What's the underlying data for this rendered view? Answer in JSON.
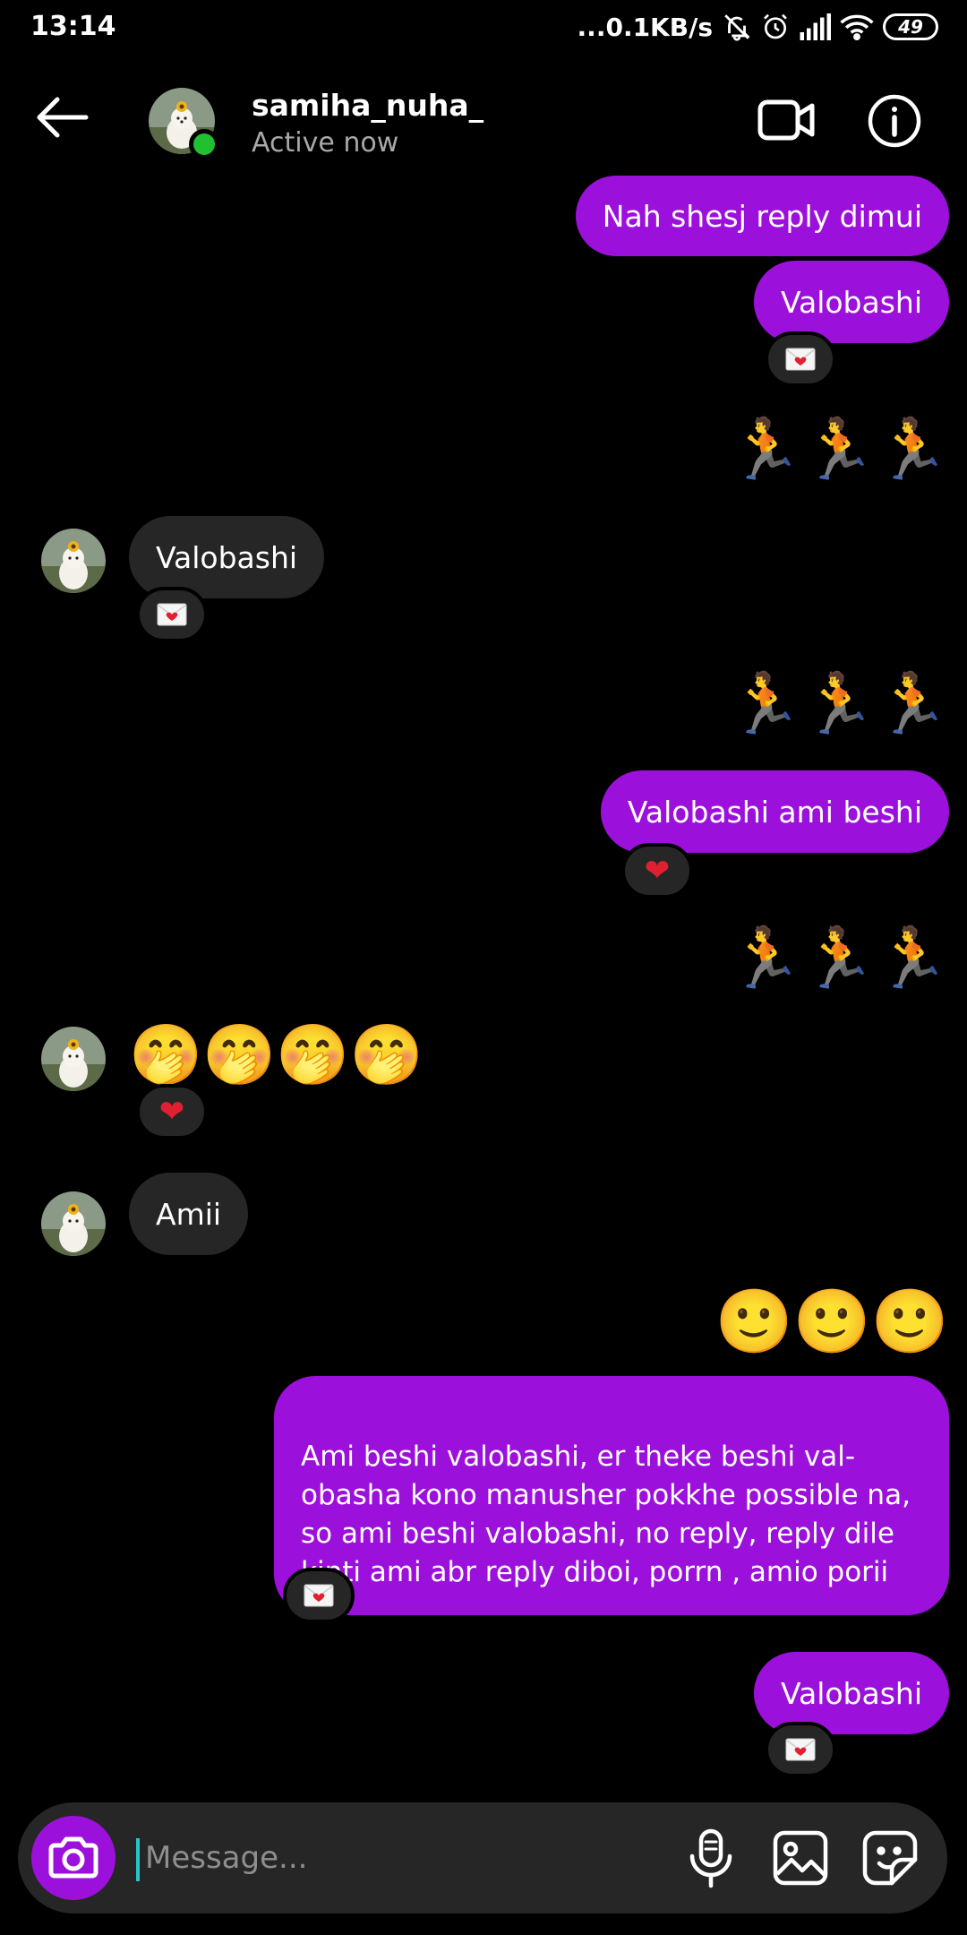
{
  "status_bar": {
    "time": "13:14",
    "network_speed": "...0.1KB/s",
    "battery": "49",
    "icons": [
      "mute-icon",
      "alarm-icon",
      "signal-icon",
      "wifi-icon",
      "battery-icon"
    ]
  },
  "header": {
    "contact_name": "samiha_nuha_",
    "contact_status": "Active now",
    "icons": [
      "back-arrow-icon",
      "video-call-icon",
      "info-icon"
    ]
  },
  "messages": [
    {
      "dir": "out",
      "text": "Nah shesj reply dimui"
    },
    {
      "dir": "out",
      "text": "Valobashi",
      "reaction": "love-letter"
    },
    {
      "dir": "out",
      "emoji": "🏃🏃🏃"
    },
    {
      "dir": "in",
      "text": "Valobashi",
      "reaction": "love-letter"
    },
    {
      "dir": "out",
      "emoji": "🏃🏃🏃"
    },
    {
      "dir": "out",
      "text": "Valobashi ami beshi",
      "reaction": "heart"
    },
    {
      "dir": "out",
      "emoji": "🏃🏃🏃"
    },
    {
      "dir": "in",
      "emoji": "🤭🤭🤭🤭",
      "reaction": "heart"
    },
    {
      "dir": "in",
      "text": "Amii"
    },
    {
      "dir": "out",
      "emoji": "🙂🙂🙂"
    },
    {
      "dir": "out",
      "text": "Ami beshi valobashi, er theke beshi val-\nobasha kono manusher pokkhe possible na,\nso ami beshi valobashi, no reply, reply dile\nkinti ami abr reply diboi, porrn , amio porii",
      "reaction": "love-letter"
    },
    {
      "dir": "out",
      "text": "Valobashi",
      "reaction": "love-letter"
    }
  ],
  "composer": {
    "placeholder": "Message...",
    "icons": [
      "camera-icon",
      "microphone-icon",
      "gallery-icon",
      "sticker-icon"
    ]
  },
  "colors": {
    "background": "#000000",
    "outgoing_bubble": "#9c10dc",
    "incoming_bubble": "#262626",
    "online": "#20c030",
    "secondary_text": "#a8a8a8"
  }
}
